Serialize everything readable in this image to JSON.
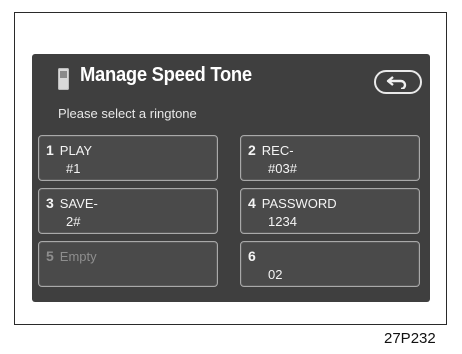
{
  "header": {
    "title": "Manage Speed Tone",
    "subtitle": "Please select a ringtone",
    "back_icon": "return-arrow-icon"
  },
  "options": [
    {
      "number": "1",
      "label": "PLAY",
      "value": "#1",
      "enabled": true
    },
    {
      "number": "2",
      "label": "REC-",
      "value": "#03#",
      "enabled": true
    },
    {
      "number": "3",
      "label": "SAVE-",
      "value": "2#",
      "enabled": true
    },
    {
      "number": "4",
      "label": "PASSWORD",
      "value": "1234",
      "enabled": true
    },
    {
      "number": "5",
      "label": "Empty",
      "value": "",
      "enabled": false
    },
    {
      "number": "6",
      "label": "",
      "value": "02",
      "enabled": true
    }
  ],
  "caption": "27P232",
  "colors": {
    "screen_bg": "#3f3f3f",
    "tile_bg": "#4a4a4a",
    "tile_border": "#a9a9a9",
    "text": "#f4f4f4",
    "disabled_text": "#8e8e8e"
  }
}
